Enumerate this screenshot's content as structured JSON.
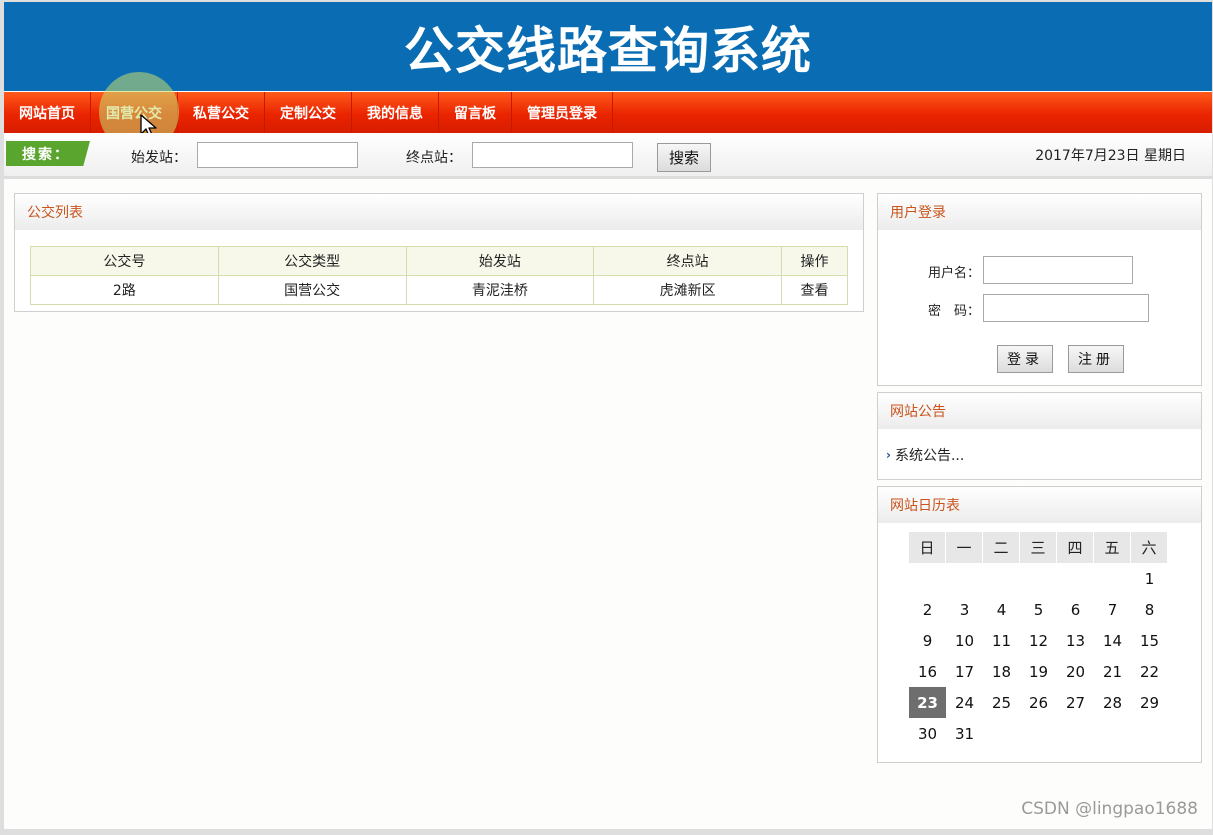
{
  "header": {
    "title": "公交线路查询系统"
  },
  "nav": {
    "items": [
      "网站首页",
      "国营公交",
      "私营公交",
      "定制公交",
      "我的信息",
      "留言板",
      "管理员登录"
    ]
  },
  "search": {
    "tag": "搜索：",
    "start_label": "始发站：",
    "end_label": "终点站：",
    "start_value": "",
    "end_value": "",
    "button": "搜索",
    "date": "2017年7月23日 星期日"
  },
  "bus_list": {
    "title": "公交列表",
    "columns": [
      "公交号",
      "公交类型",
      "始发站",
      "终点站",
      "操作"
    ],
    "rows": [
      [
        "2路",
        "国营公交",
        "青泥洼桥",
        "虎滩新区",
        "查看"
      ]
    ]
  },
  "login": {
    "title": "用户登录",
    "username_label": "用户名：",
    "password_label": "密　码：",
    "username_value": "",
    "password_value": "",
    "login_button": "登录",
    "register_button": "注册"
  },
  "notice": {
    "title": "网站公告",
    "items": [
      "系统公告..."
    ]
  },
  "calendar": {
    "title": "网站日历表",
    "weekdays": [
      "日",
      "一",
      "二",
      "三",
      "四",
      "五",
      "六"
    ],
    "first_weekday": 6,
    "days_in_month": 31,
    "today": 23
  },
  "watermark": "CSDN @lingpao1688",
  "colors": {
    "banner": "#0a6db3",
    "nav": "#ea2400",
    "panel_title": "#c9541c",
    "search_tag": "#5aa52e"
  }
}
